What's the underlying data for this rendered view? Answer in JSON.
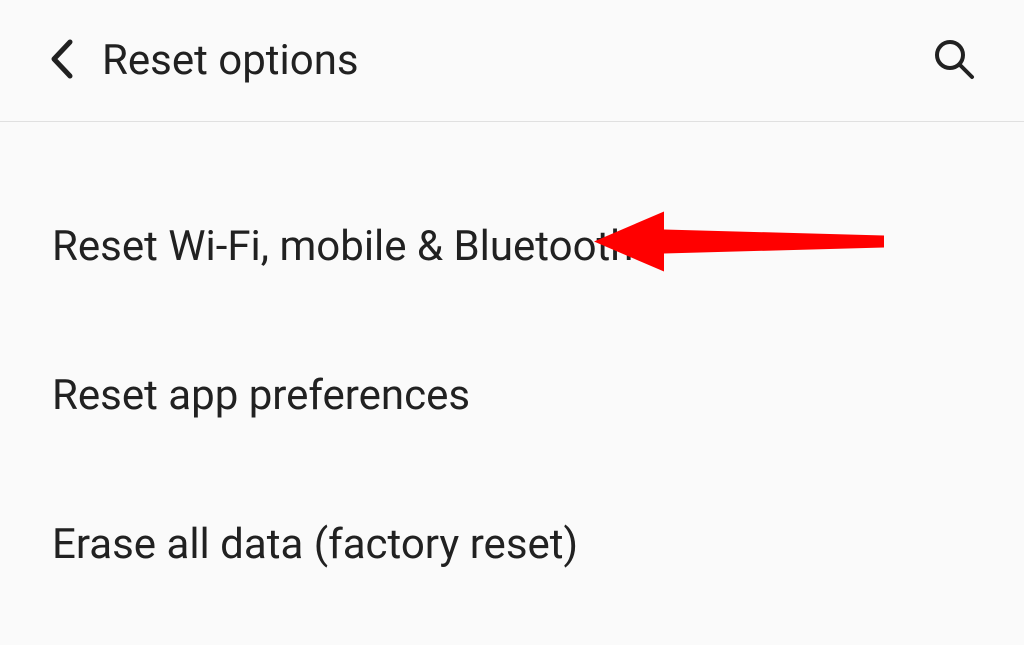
{
  "header": {
    "title": "Reset options"
  },
  "options": [
    {
      "label": "Reset Wi-Fi, mobile & Bluetooth",
      "highlighted": true
    },
    {
      "label": "Reset app preferences",
      "highlighted": false
    },
    {
      "label": "Erase all data (factory reset)",
      "highlighted": false
    }
  ],
  "annotation": {
    "color": "#ff0000"
  }
}
